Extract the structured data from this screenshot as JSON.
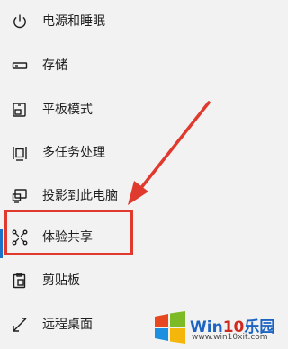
{
  "menu": {
    "items": [
      {
        "icon": "power-icon",
        "label": "电源和睡眠"
      },
      {
        "icon": "storage-icon",
        "label": "存储"
      },
      {
        "icon": "tablet-mode-icon",
        "label": "平板模式"
      },
      {
        "icon": "multitasking-icon",
        "label": "多任务处理"
      },
      {
        "icon": "project-to-pc-icon",
        "label": "投影到此电脑"
      },
      {
        "icon": "shared-experiences-icon",
        "label": "体验共享"
      },
      {
        "icon": "clipboard-icon",
        "label": "剪贴板"
      },
      {
        "icon": "remote-desktop-icon",
        "label": "远程桌面"
      }
    ],
    "selected_index": 5
  },
  "watermark": {
    "brand_prefix": "Win",
    "brand_number": "10",
    "brand_suffix": "乐园",
    "url": "www.win10xit.com"
  },
  "colors": {
    "background": "#f2f2f2",
    "text": "#1e1e1e",
    "annotation_red": "#e03a2e",
    "accent_blue": "#1a73c9"
  }
}
